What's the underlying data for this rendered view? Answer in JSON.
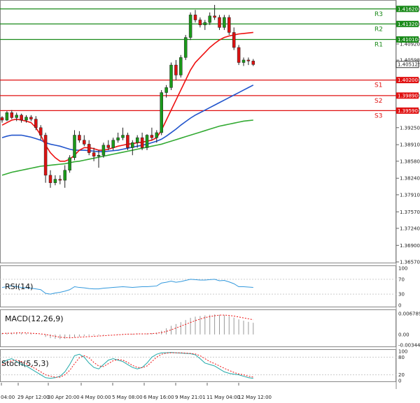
{
  "chart_data": {
    "type": "candlestick",
    "main_panel": {
      "price_axis": {
        "min": 1.3657,
        "max": 1.4177,
        "ticks": [
          "1.41620",
          "1.41320",
          "1.41010",
          "1.40920",
          "1.40598",
          "1.40512",
          "1.40200",
          "1.39890",
          "1.39590",
          "1.39250",
          "1.38910",
          "1.38580",
          "1.38240",
          "1.37910",
          "1.37570",
          "1.37240",
          "1.36900",
          "1.36570"
        ]
      },
      "current_price": "1.40512",
      "levels": [
        {
          "name": "R3",
          "value": 1.4162,
          "label": "1.41620",
          "color": "#1a8a1a"
        },
        {
          "name": "R2",
          "value": 1.4132,
          "label": "1.41320",
          "color": "#1a8a1a"
        },
        {
          "name": "R1",
          "value": 1.4101,
          "label": "1.41010",
          "color": "#1a8a1a"
        },
        {
          "name": "S1",
          "value": 1.402,
          "label": "1.40200",
          "color": "#e01010"
        },
        {
          "name": "S2",
          "value": 1.3989,
          "label": "1.39890",
          "color": "#e01010"
        },
        {
          "name": "S3",
          "value": 1.3959,
          "label": "1.39590",
          "color": "#e01010"
        }
      ],
      "candles": [
        [
          1.3945,
          1.3948,
          1.3935,
          1.394
        ],
        [
          1.394,
          1.3958,
          1.3938,
          1.3955
        ],
        [
          1.3955,
          1.396,
          1.3942,
          1.3945
        ],
        [
          1.3945,
          1.3955,
          1.3938,
          1.395
        ],
        [
          1.395,
          1.3953,
          1.3935,
          1.394
        ],
        [
          1.394,
          1.395,
          1.3935,
          1.3946
        ],
        [
          1.3946,
          1.395,
          1.3938,
          1.3942
        ],
        [
          1.3942,
          1.3948,
          1.392,
          1.3925
        ],
        [
          1.3925,
          1.393,
          1.39,
          1.391
        ],
        [
          1.391,
          1.3915,
          1.3815,
          1.383
        ],
        [
          1.383,
          1.384,
          1.3805,
          1.3815
        ],
        [
          1.3815,
          1.383,
          1.381,
          1.3822
        ],
        [
          1.3822,
          1.383,
          1.3812,
          1.382
        ],
        [
          1.382,
          1.385,
          1.3805,
          1.384
        ],
        [
          1.384,
          1.387,
          1.3835,
          1.3865
        ],
        [
          1.3865,
          1.392,
          1.386,
          1.391
        ],
        [
          1.391,
          1.3918,
          1.3895,
          1.39
        ],
        [
          1.39,
          1.391,
          1.3888,
          1.3892
        ],
        [
          1.3892,
          1.39,
          1.387,
          1.3875
        ],
        [
          1.3875,
          1.3885,
          1.3858,
          1.3868
        ],
        [
          1.3868,
          1.388,
          1.3845,
          1.387
        ],
        [
          1.387,
          1.3895,
          1.3865,
          1.389
        ],
        [
          1.389,
          1.39,
          1.388,
          1.3885
        ],
        [
          1.3885,
          1.3905,
          1.388,
          1.39
        ],
        [
          1.39,
          1.3915,
          1.3895,
          1.3905
        ],
        [
          1.3905,
          1.3925,
          1.39,
          1.391
        ],
        [
          1.391,
          1.3915,
          1.388,
          1.3885
        ],
        [
          1.3885,
          1.39,
          1.387,
          1.3895
        ],
        [
          1.3895,
          1.391,
          1.3885,
          1.3905
        ],
        [
          1.3905,
          1.3915,
          1.388,
          1.3885
        ],
        [
          1.3885,
          1.3912,
          1.388,
          1.391
        ],
        [
          1.391,
          1.3925,
          1.39,
          1.3905
        ],
        [
          1.3905,
          1.392,
          1.3895,
          1.3915
        ],
        [
          1.3915,
          1.4,
          1.391,
          1.3995
        ],
        [
          1.3995,
          1.401,
          1.3985,
          1.4005
        ],
        [
          1.4005,
          1.4055,
          1.4,
          1.405
        ],
        [
          1.405,
          1.406,
          1.402,
          1.403
        ],
        [
          1.403,
          1.407,
          1.4025,
          1.4065
        ],
        [
          1.4065,
          1.411,
          1.406,
          1.4105
        ],
        [
          1.4105,
          1.4155,
          1.41,
          1.415
        ],
        [
          1.415,
          1.416,
          1.4135,
          1.414
        ],
        [
          1.414,
          1.4145,
          1.4125,
          1.413
        ],
        [
          1.413,
          1.414,
          1.412,
          1.4135
        ],
        [
          1.4135,
          1.4155,
          1.413,
          1.4148
        ],
        [
          1.4148,
          1.417,
          1.414,
          1.4145
        ],
        [
          1.4145,
          1.415,
          1.412,
          1.4125
        ],
        [
          1.4125,
          1.415,
          1.412,
          1.4145
        ],
        [
          1.4145,
          1.415,
          1.411,
          1.4115
        ],
        [
          1.4115,
          1.4125,
          1.408,
          1.4085
        ],
        [
          1.4085,
          1.409,
          1.405,
          1.4055
        ],
        [
          1.4055,
          1.4065,
          1.4048,
          1.406
        ],
        [
          1.406,
          1.4065,
          1.405,
          1.4058
        ],
        [
          1.4058,
          1.4062,
          1.4048,
          1.4051
        ]
      ],
      "ma_fast": [
        1.393,
        1.3935,
        1.394,
        1.3942,
        1.394,
        1.3938,
        1.3935,
        1.3925,
        1.391,
        1.389,
        1.3875,
        1.3865,
        1.3858,
        1.3858,
        1.3862,
        1.387,
        1.388,
        1.3885,
        1.3885,
        1.3883,
        1.388,
        1.388,
        1.3882,
        1.3885,
        1.3888,
        1.389,
        1.3892,
        1.3893,
        1.3895,
        1.3896,
        1.3898,
        1.39,
        1.3905,
        1.392,
        1.394,
        1.396,
        1.398,
        1.4,
        1.402,
        1.404,
        1.4055,
        1.4065,
        1.4075,
        1.4085,
        1.4093,
        1.41,
        1.4105,
        1.4108,
        1.411,
        1.4112,
        1.4113,
        1.4114,
        1.4115
      ],
      "ma_mid": [
        1.3905,
        1.3908,
        1.391,
        1.391,
        1.391,
        1.3908,
        1.3906,
        1.3903,
        1.39,
        1.3895,
        1.3892,
        1.389,
        1.3888,
        1.3885,
        1.3882,
        1.388,
        1.388,
        1.388,
        1.3879,
        1.3878,
        1.3877,
        1.3877,
        1.3878,
        1.3879,
        1.388,
        1.3882,
        1.3884,
        1.3886,
        1.3888,
        1.389,
        1.3892,
        1.3895,
        1.3898,
        1.3902,
        1.3908,
        1.3915,
        1.3922,
        1.393,
        1.3937,
        1.3944,
        1.395,
        1.3955,
        1.396,
        1.3965,
        1.397,
        1.3975,
        1.398,
        1.3985,
        1.399,
        1.3995,
        1.4,
        1.4005,
        1.401
      ],
      "ma_slow": [
        1.383,
        1.3833,
        1.3836,
        1.3838,
        1.384,
        1.3842,
        1.3844,
        1.3846,
        1.3848,
        1.3849,
        1.385,
        1.3851,
        1.3852,
        1.3853,
        1.3855,
        1.3857,
        1.3858,
        1.386,
        1.3862,
        1.3864,
        1.3866,
        1.3868,
        1.387,
        1.3872,
        1.3874,
        1.3876,
        1.3878,
        1.388,
        1.3882,
        1.3884,
        1.3886,
        1.3888,
        1.389,
        1.3892,
        1.3895,
        1.3898,
        1.3901,
        1.3904,
        1.3907,
        1.391,
        1.3913,
        1.3916,
        1.3919,
        1.3922,
        1.3925,
        1.3928,
        1.393,
        1.3932,
        1.3934,
        1.3936,
        1.3938,
        1.3939,
        1.394
      ]
    },
    "rsi": {
      "label": "RSI(14)",
      "ticks": [
        "100",
        "70",
        "30",
        "0"
      ],
      "values": [
        48,
        50,
        52,
        50,
        48,
        47,
        46,
        44,
        42,
        32,
        30,
        33,
        35,
        38,
        42,
        50,
        48,
        47,
        45,
        44,
        44,
        46,
        47,
        48,
        49,
        50,
        49,
        48,
        49,
        50,
        50,
        51,
        52,
        60,
        62,
        65,
        62,
        64,
        67,
        70,
        69,
        68,
        68,
        69,
        70,
        66,
        67,
        63,
        58,
        50,
        50,
        49,
        48
      ]
    },
    "macd": {
      "label": "MACD(12,26,9)",
      "ticks": [
        "0.006789",
        "0.00",
        "-0.003441"
      ],
      "hist": [
        0.0005,
        0.0005,
        0.0006,
        0.0006,
        0.0005,
        0.0004,
        0.0003,
        0.0001,
        -0.0001,
        -0.0008,
        -0.0012,
        -0.0014,
        -0.0015,
        -0.0014,
        -0.0012,
        -0.0009,
        -0.0007,
        -0.0005,
        -0.0004,
        -0.0003,
        -0.0003,
        -0.0002,
        -0.0001,
        0.0,
        0.0001,
        0.0002,
        0.0002,
        0.0002,
        0.0003,
        0.0003,
        0.0003,
        0.0004,
        0.0006,
        0.0012,
        0.002,
        0.0028,
        0.0034,
        0.004,
        0.0047,
        0.0054,
        0.0058,
        0.006,
        0.0062,
        0.0064,
        0.0065,
        0.0064,
        0.0063,
        0.006,
        0.0055,
        0.0049,
        0.0045,
        0.0041,
        0.0038
      ],
      "signal": [
        0.0003,
        0.0004,
        0.0004,
        0.0005,
        0.0005,
        0.0005,
        0.0004,
        0.0003,
        0.0002,
        0.0,
        -0.0003,
        -0.0006,
        -0.0009,
        -0.001,
        -0.0011,
        -0.001,
        -0.0009,
        -0.0008,
        -0.0007,
        -0.0006,
        -0.0005,
        -0.0004,
        -0.0003,
        -0.0002,
        -0.0001,
        0.0,
        0.0001,
        0.0001,
        0.0002,
        0.0002,
        0.0002,
        0.0003,
        0.0004,
        0.0006,
        0.001,
        0.0015,
        0.0021,
        0.0027,
        0.0033,
        0.0039,
        0.0045,
        0.005,
        0.0055,
        0.0058,
        0.0061,
        0.0063,
        0.0063,
        0.0062,
        0.006,
        0.0057,
        0.0054,
        0.0051,
        0.0048
      ]
    },
    "stoch": {
      "label": "Stoch(5,5,3)",
      "ticks": [
        "100",
        "80",
        "20",
        "0"
      ],
      "k": [
        60,
        70,
        75,
        65,
        55,
        50,
        40,
        30,
        20,
        10,
        8,
        10,
        15,
        30,
        55,
        85,
        90,
        80,
        60,
        45,
        40,
        55,
        70,
        75,
        70,
        65,
        55,
        45,
        40,
        45,
        60,
        80,
        90,
        95,
        95,
        96,
        95,
        94,
        93,
        92,
        88,
        75,
        60,
        55,
        50,
        40,
        30,
        25,
        22,
        20,
        15,
        10,
        8
      ],
      "d": [
        55,
        62,
        68,
        70,
        65,
        58,
        48,
        40,
        30,
        20,
        15,
        12,
        12,
        20,
        35,
        58,
        78,
        85,
        78,
        62,
        50,
        48,
        58,
        68,
        72,
        70,
        62,
        52,
        45,
        44,
        50,
        65,
        80,
        90,
        94,
        95,
        95,
        95,
        94,
        93,
        91,
        85,
        75,
        65,
        58,
        50,
        42,
        35,
        28,
        23,
        20,
        15,
        12
      ]
    },
    "time_labels": [
      "04:00",
      "29 Apr 12:00",
      "30 Apr 20:00",
      "4 May 00:00",
      "5 May 08:00",
      "6 May 16:00",
      "9 May 21:01",
      "11 May 04:00",
      "12 May 12:00"
    ],
    "colors": {
      "bull": "#1a9a1a",
      "bear": "#dd1111",
      "ma_fast": "#ee1111",
      "ma_mid": "#2255cc",
      "ma_slow": "#33aa33",
      "rsi": "#3399dd",
      "macd_signal": "#ee1111",
      "stoch_k": "#22aaaa",
      "stoch_d": "#ee1111"
    }
  }
}
